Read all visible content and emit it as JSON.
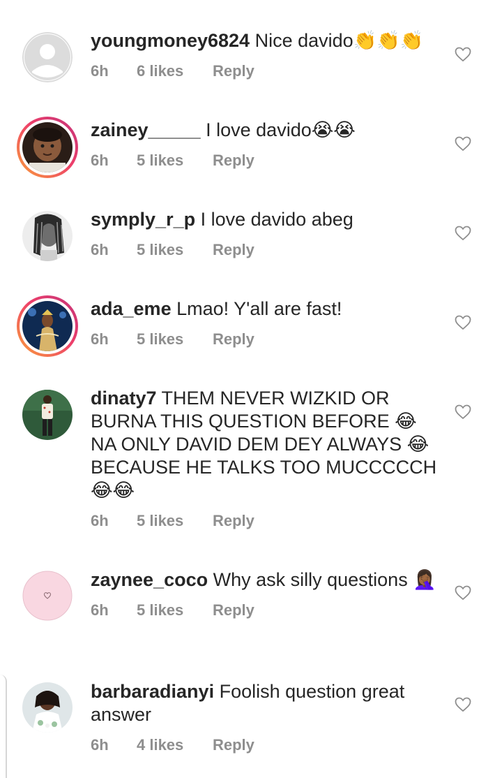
{
  "comments": [
    {
      "username": "youngmoney6824",
      "text": " Nice davido",
      "emoji": "👏👏👏",
      "time": "6h",
      "likes": "6 likes",
      "reply": "Reply",
      "avatar": "placeholder-avatar"
    },
    {
      "username": "zainey_____",
      "text": " I love davido",
      "emoji": "😭😭",
      "time": "6h",
      "likes": "5 likes",
      "reply": "Reply",
      "avatar": "child-photo-avatar"
    },
    {
      "username": "symply_r_p",
      "text": " I love davido abeg",
      "time": "6h",
      "likes": "5 likes",
      "reply": "Reply",
      "avatar": "braids-photo-avatar"
    },
    {
      "username": "ada_eme",
      "text": " Lmao! Y'all are fast!",
      "time": "6h",
      "likes": "5 likes",
      "reply": "Reply",
      "avatar": "pageant-photo-avatar"
    },
    {
      "username": "dinaty7",
      "text": " THEM NEVER WIZKID OR BURNA THIS QUESTION BEFORE 😂 NA ONLY DAVID DEM DEY ALWAYS 😂 BECAUSE HE TALKS TOO MUCCCCCH 😂😂",
      "time": "6h",
      "likes": "5 likes",
      "reply": "Reply",
      "avatar": "standing-man-avatar"
    },
    {
      "username": "zaynee_coco",
      "text": " Why ask silly questions 🤦🏾‍♀️",
      "time": "6h",
      "likes": "5 likes",
      "reply": "Reply",
      "avatar": "pink-heart-avatar"
    },
    {
      "username": "barbaradianyi",
      "text": " Foolish question great answer",
      "time": "6h",
      "likes": "4 likes",
      "reply": "Reply",
      "avatar": "bride-photo-avatar"
    }
  ],
  "icons": {
    "like": "heart-outline-icon"
  },
  "colors": {
    "text": "#262626",
    "meta": "#8e8e8e",
    "story_ring_start": "#f9a13a",
    "story_ring_end": "#c2347a",
    "placeholder_avatar": "#d9d9d9",
    "pink_avatar": "#f9d7e1"
  }
}
